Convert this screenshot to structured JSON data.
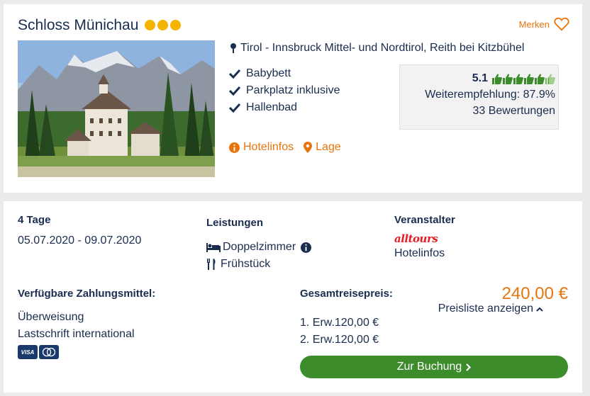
{
  "hotel": {
    "name": "Schloss Münichau",
    "stars": 3,
    "merken_label": "Merken",
    "location": "Tirol - Innsbruck Mittel- und Nordtirol, Reith bei Kitzbühel",
    "features": [
      "Babybett",
      "Parkplatz inklusive",
      "Hallenbad"
    ],
    "links": {
      "hotelinfos": "Hotelinfos",
      "lage": "Lage"
    },
    "rating": {
      "score": "5.1",
      "thumbs_total": 6,
      "thumbs_filled": 5.1,
      "recommendation": "Weiterempfehlung: 87.9%",
      "reviews": "33 Bewertungen"
    }
  },
  "offer": {
    "duration": "4 Tage",
    "dates": "05.07.2020 - 09.07.2020",
    "services_label": "Leistungen",
    "room": "Doppelzimmer",
    "board": "Frühstück",
    "operator_label": "Veranstalter",
    "operator_logo": "alltours",
    "operator_link": "Hotelinfos",
    "payment_label": "Verfügbare Zahlungsmittel:",
    "payment_methods": [
      "Überweisung",
      "Lastschrift international"
    ],
    "cards": [
      "VISA",
      "MC"
    ],
    "total_label": "Gesamtreisepreis:",
    "total_price": "240,00 €",
    "pricelist_label": "Preisliste anzeigen",
    "travellers": [
      "1. Erw.120,00 €",
      "2. Erw.120,00 €"
    ],
    "book_label": "Zur Buchung"
  },
  "colors": {
    "accent": "#e8740c",
    "book_button": "#3c8c2c",
    "text": "#1a2d4f",
    "stars": "#f5b400",
    "thumbs": "#3c8c2c"
  }
}
